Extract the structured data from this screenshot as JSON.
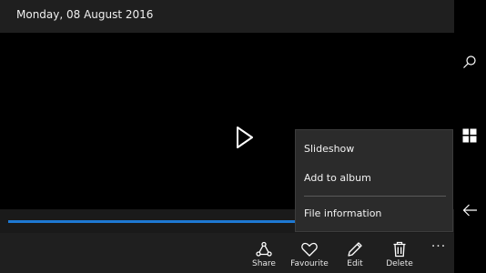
{
  "header": {
    "date": "Monday, 08 August 2016"
  },
  "video": {
    "progress_percent": 67
  },
  "app_bar": {
    "buttons": [
      {
        "label": "Share",
        "icon": "share-icon"
      },
      {
        "label": "Favourite",
        "icon": "heart-icon"
      },
      {
        "label": "Edit",
        "icon": "pencil-icon"
      },
      {
        "label": "Delete",
        "icon": "trash-icon"
      }
    ],
    "more": "···"
  },
  "menu": {
    "items": [
      {
        "label": "Slideshow"
      },
      {
        "label": "Add to album"
      },
      {
        "label": "File information"
      }
    ]
  },
  "nav": {
    "icons": [
      "search-icon",
      "windows-start-icon",
      "back-arrow-icon"
    ]
  },
  "colors": {
    "accent": "#1e78d2",
    "bar_background": "#1f1f1f",
    "menu_background": "#2b2b2b"
  }
}
